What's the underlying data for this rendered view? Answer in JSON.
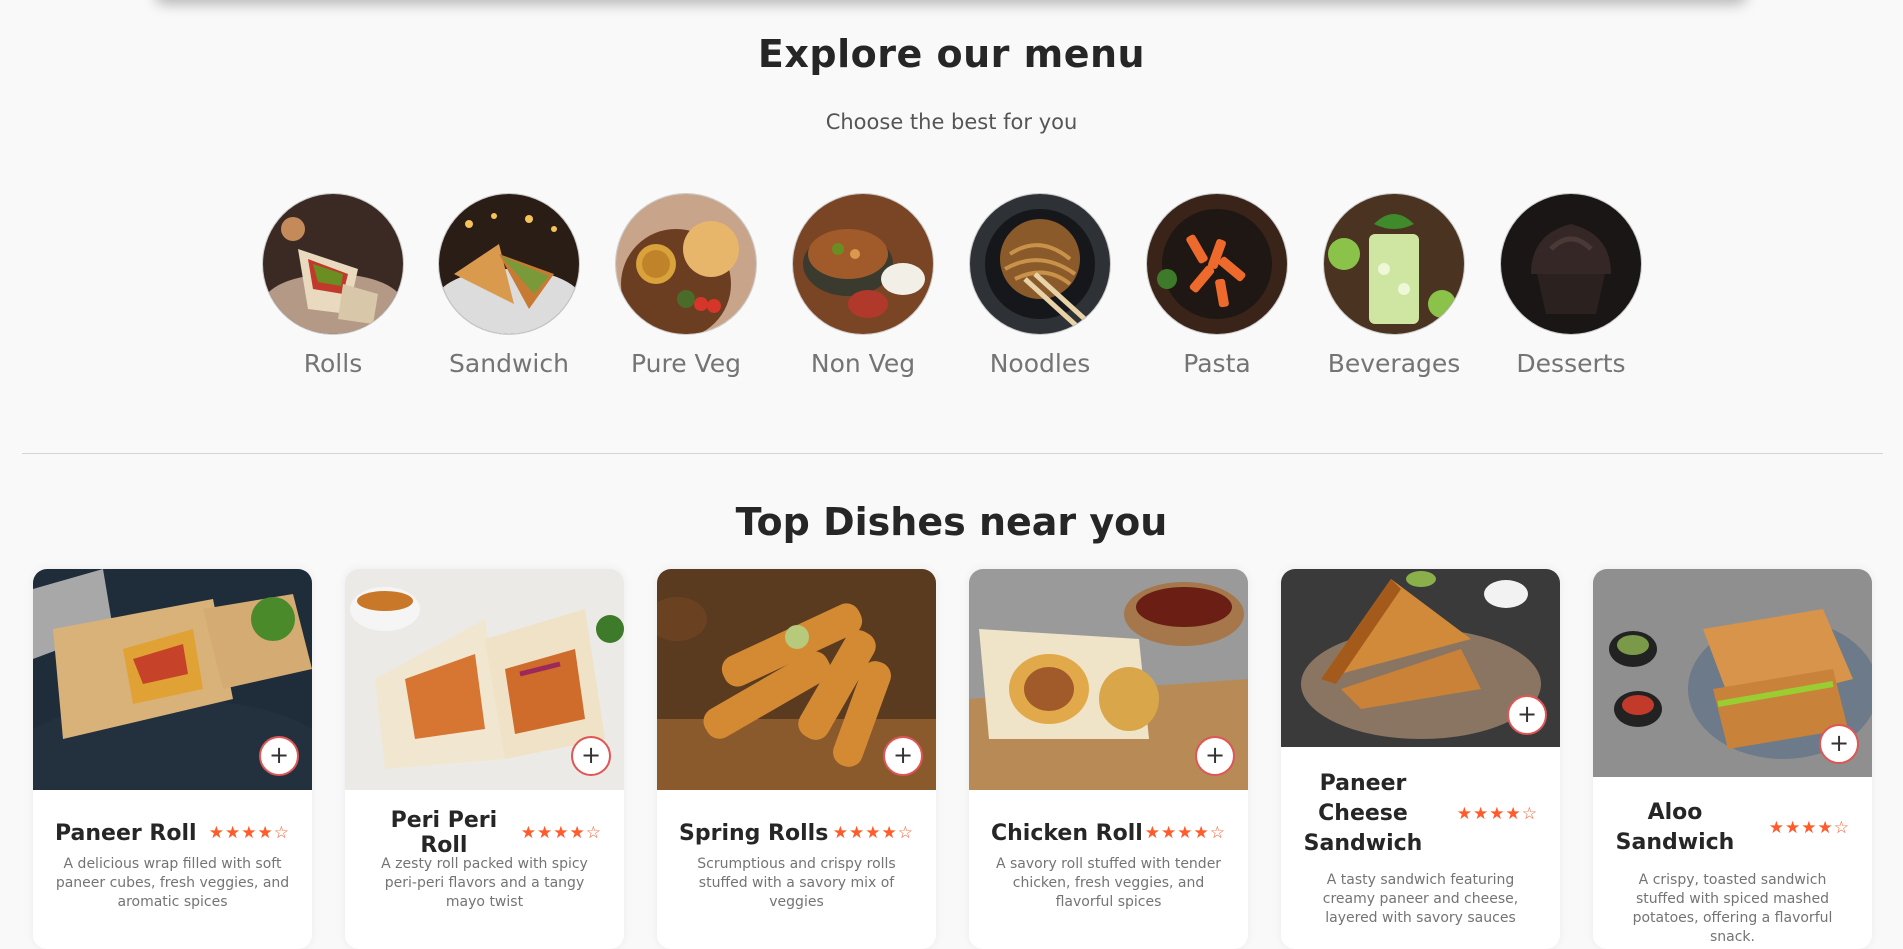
{
  "menu": {
    "title": "Explore our menu",
    "subtitle": "Choose the best for you",
    "categories": [
      {
        "label": "Rolls"
      },
      {
        "label": "Sandwich"
      },
      {
        "label": "Pure Veg"
      },
      {
        "label": "Non Veg"
      },
      {
        "label": "Noodles"
      },
      {
        "label": "Pasta"
      },
      {
        "label": "Beverages"
      },
      {
        "label": "Desserts"
      }
    ]
  },
  "dishes": {
    "title": "Top Dishes near you",
    "add_label": "+",
    "items": [
      {
        "name": "Paneer Roll",
        "rating": 4,
        "stars": "★★★★☆",
        "description": "A delicious wrap filled with soft paneer cubes, fresh veggies, and aromatic spices"
      },
      {
        "name": "Peri Peri Roll",
        "rating": 4,
        "stars": "★★★★☆",
        "description": "A zesty roll packed with spicy peri-peri flavors and a tangy mayo twist"
      },
      {
        "name": "Spring Rolls",
        "rating": 4,
        "stars": "★★★★☆",
        "description": "Scrumptious and crispy rolls stuffed with a savory mix of veggies"
      },
      {
        "name": "Chicken Roll",
        "rating": 4,
        "stars": "★★★★☆",
        "description": "A savory roll stuffed with tender chicken, fresh veggies, and flavorful spices"
      },
      {
        "name": "Paneer Cheese Sandwich",
        "rating": 4,
        "stars": "★★★★☆",
        "description": "A tasty sandwich featuring creamy paneer and cheese, layered with savory sauces"
      },
      {
        "name": "Aloo Sandwich",
        "rating": 4,
        "stars": "★★★★☆",
        "description": "A crispy, toasted sandwich stuffed with spiced mashed potatoes, offering a flavorful snack."
      }
    ]
  },
  "colors": {
    "accent": "#ff5b2b",
    "add_button_border": "#e05555",
    "background": "#f9f9f9"
  }
}
